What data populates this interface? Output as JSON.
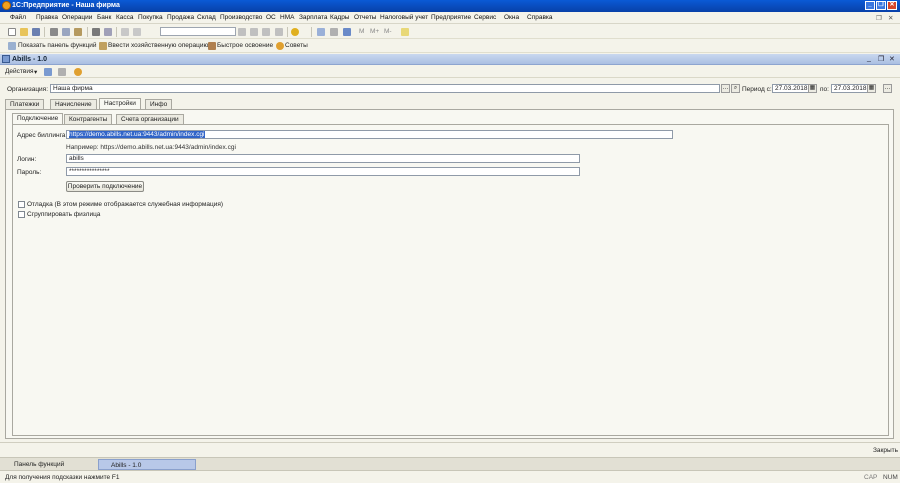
{
  "window": {
    "title": "1С:Предприятие - Наша фирма",
    "min": "_",
    "restore": "❐",
    "close": "✕"
  },
  "menu": [
    "Файл",
    "Правка",
    "Операции",
    "Банк",
    "Касса",
    "Покупка",
    "Продажа",
    "Склад",
    "Производство",
    "ОС",
    "НМА",
    "Зарплата",
    "Кадры",
    "Отчеты",
    "Налоговый учет",
    "Предприятие",
    "Сервис",
    "Окна",
    "Справка"
  ],
  "toolbar2": {
    "show_panel": "Показать панель функций",
    "enter_op": "Ввести хозяйственную операцию",
    "quick": "Быстрое освоение",
    "tips": "Советы"
  },
  "form": {
    "title": "Abills - 1.0",
    "actions_label": "Действия",
    "org_label": "Организация:",
    "org_value": "Наша фирма",
    "period_label": "Период с:",
    "period_from": "27.03.2018",
    "period_to_label": "по:",
    "period_to": "27.03.2018",
    "tabs": [
      "Платежки",
      "Начисление",
      "Настройки",
      "Инфо"
    ],
    "active_tab": "Настройки",
    "subtabs": [
      "Подключение",
      "Контрагенты",
      "Счета организации"
    ],
    "active_subtab": "Подключение",
    "billing_label": "Адрес биллинга:",
    "billing_value": "https://demo.abills.net.ua:9443/admin/index.cgi",
    "example_text": "Например: https://demo.abills.net.ua:9443/admin/index.cgi",
    "login_label": "Логин:",
    "login_value": "abills",
    "password_label": "Пароль:",
    "password_value": "****************",
    "check_button": "Проверить подключение",
    "debug_label": "Отладка (В этом режиме отображается служебная информация)",
    "group_label": "Сгруппировать физлица",
    "close_button": "Закрыть"
  },
  "taskbar": {
    "panel": "Панель функций",
    "form": "Abills - 1.0"
  },
  "status": {
    "hint": "Для получения подсказки нажмите F1",
    "cap": "CAP",
    "num": "NUM"
  }
}
